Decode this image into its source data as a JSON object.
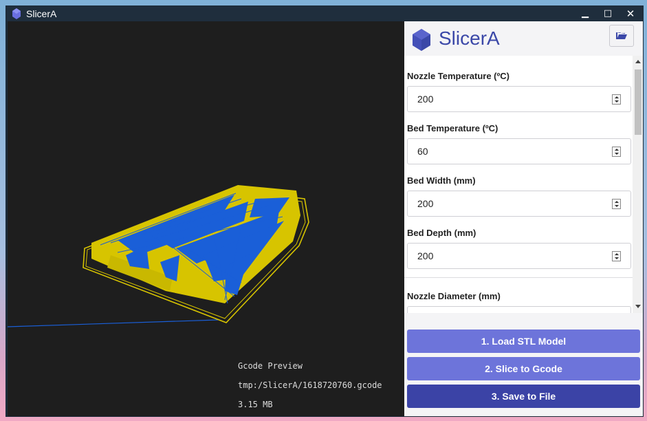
{
  "window": {
    "title": "SlicerA",
    "controls": {
      "minimize": "▁",
      "maximize": "□",
      "close": "✕"
    }
  },
  "icons": {
    "app": "gem-icon",
    "open_folder": "folder-open-icon"
  },
  "colors": {
    "brand": "#3b48a8",
    "button_primary": "#6d74da",
    "button_dark": "#3b43a6",
    "model_fill": "#d7c400",
    "toolpath": "#1a5fd8",
    "viewport_bg": "#1e1e1e"
  },
  "viewport": {
    "info_title": "Gcode Preview",
    "info_path": "tmp:/SlicerA/1618720760.gcode",
    "info_size": "3.15 MB"
  },
  "panel": {
    "brand_name": "SlicerA",
    "fields": [
      {
        "label": "Nozzle Temperature (ºC)",
        "value": "200"
      },
      {
        "label": "Bed Temperature (ºC)",
        "value": "60"
      },
      {
        "label": "Bed Width (mm)",
        "value": "200"
      },
      {
        "label": "Bed Depth (mm)",
        "value": "200"
      },
      {
        "label": "Nozzle Diameter (mm)",
        "value": ""
      }
    ],
    "buttons": {
      "load": "1. Load STL Model",
      "slice": "2. Slice to Gcode",
      "save": "3. Save to File"
    }
  }
}
